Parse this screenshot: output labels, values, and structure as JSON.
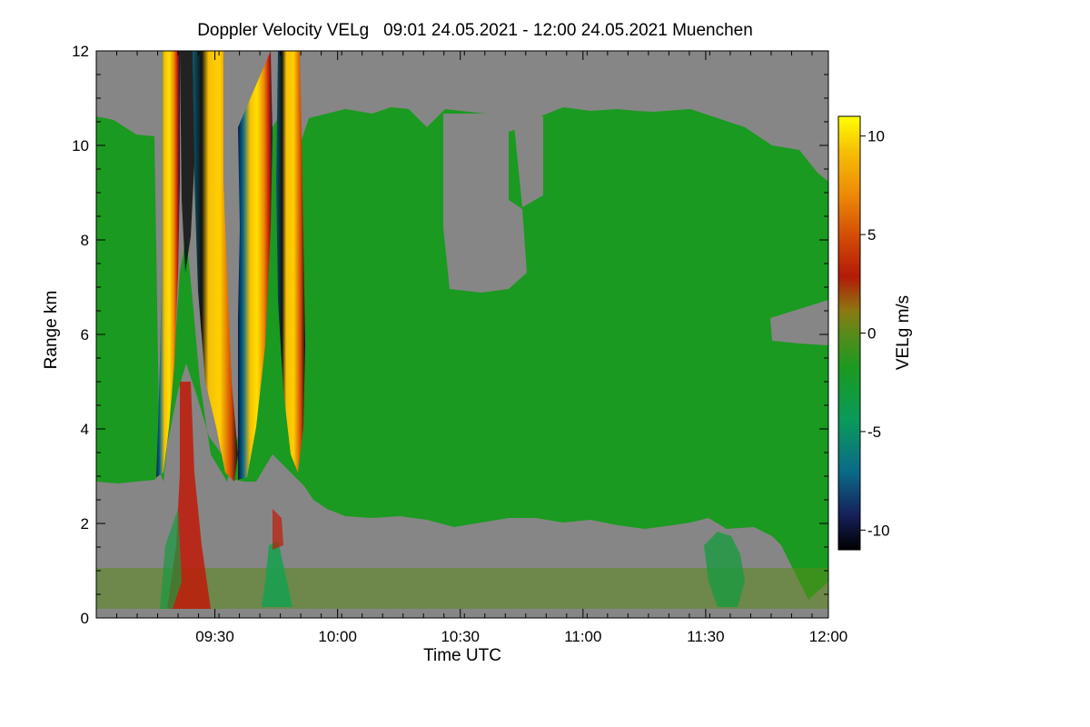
{
  "chart_data": {
    "type": "heatmap",
    "title": "Doppler Velocity VELg   09:01 24.05.2021 - 12:00 24.05.2021 Muenchen",
    "xlabel": "Time UTC",
    "ylabel": "Range km",
    "colorbar_label": "VELg m/s",
    "x_tick_labels": [
      "09:30",
      "10:00",
      "10:30",
      "11:00",
      "11:30",
      "12:00"
    ],
    "y_tick_labels": [
      "0",
      "2",
      "4",
      "6",
      "8",
      "10",
      "12"
    ],
    "colorbar_tick_labels": [
      "10",
      "5",
      "0",
      "-5",
      "-10"
    ],
    "xlim_minutes_utc": [
      541,
      720
    ],
    "ylim_km": [
      0,
      12
    ],
    "colorbar_range_ms": [
      -11,
      11
    ],
    "colormap": [
      "#000000",
      "#16205a",
      "#0a6a88",
      "#0a9a5a",
      "#1a9a20",
      "#5a8a1a",
      "#8a7a10",
      "#b41a08",
      "#d24a06",
      "#ee8a06",
      "#f6c004",
      "#ffff00"
    ],
    "no_data_color": "#868686",
    "features": [
      {
        "desc": "fall streaks with folded velocities",
        "x_start": "09:16",
        "x_end": "09:52",
        "range_km": [
          3,
          12
        ]
      },
      {
        "desc": "cloud layer near-zero / slightly negative velocity",
        "x_start": "09:01",
        "x_end": "12:00",
        "range_km": [
          2,
          10.5
        ]
      },
      {
        "desc": "boundary layer noise",
        "x_start": "09:01",
        "x_end": "12:00",
        "range_km": [
          0,
          1
        ]
      }
    ]
  }
}
